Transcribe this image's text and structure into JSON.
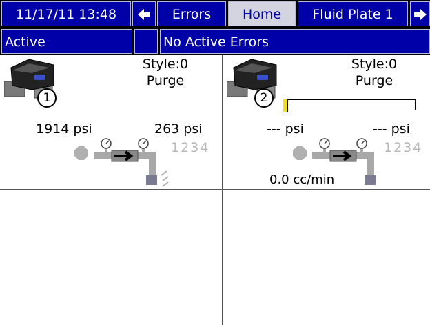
{
  "header": {
    "datetime": "11/17/11 13:48",
    "tabs": [
      {
        "label": "Errors",
        "selected": false
      },
      {
        "label": "Home",
        "selected": true
      },
      {
        "label": "Fluid Plate 1",
        "selected": false
      }
    ]
  },
  "status": {
    "state": "Active",
    "message": "No Active Errors"
  },
  "panels": [
    {
      "number": "1",
      "style": "Style:0",
      "mode": "Purge",
      "pressure_in": "1914 psi",
      "pressure_out": "263 psi",
      "steps": "1234"
    },
    {
      "number": "2",
      "style": "Style:0",
      "mode": "Purge",
      "pressure_in": "--- psi",
      "pressure_out": "--- psi",
      "steps": "1234",
      "flow": "0.0 cc/min",
      "progress": 0.0
    }
  ],
  "colors": {
    "bar_blue": "#0000a8",
    "selected_tab": "#d4d4e0",
    "progress_marker": "#f0e020"
  },
  "icons": {
    "back_arrow": "arrow-left-icon",
    "forward_arrow": "arrow-right-icon"
  }
}
